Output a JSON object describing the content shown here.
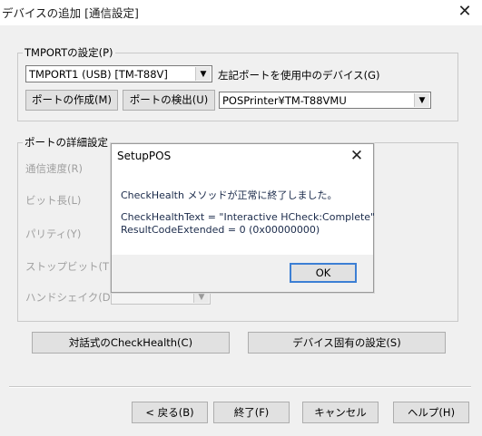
{
  "window": {
    "title": "デバイスの追加 [通信設定]",
    "close_glyph": "✕"
  },
  "tmport": {
    "group_label": "TMPORTの設定(P)",
    "port_combo_value": "TMPORT1 (USB) [TM-T88V]",
    "devices_label": "左記ポートを使用中のデバイス(G)",
    "create_port_button": "ポートの作成(M)",
    "detect_port_button": "ポートの検出(U)",
    "device_combo_value": "POSPrinter¥TM-T88VMU"
  },
  "port_details": {
    "group_label": "ポートの詳細設定",
    "fields": [
      {
        "label": "通信速度(R)"
      },
      {
        "label": "ビット長(L)"
      },
      {
        "label": "パリティ(Y)"
      },
      {
        "label": "ストップビット(T)"
      },
      {
        "label": "ハンドシェイク(D)"
      }
    ]
  },
  "actions": {
    "checkhealth_button": "対話式のCheckHealth(C)",
    "device_settings_button": "デバイス固有の設定(S)"
  },
  "footer": {
    "back_button": "< 戻る(B)",
    "finish_button": "終了(F)",
    "cancel_button": "キャンセル",
    "help_button": "ヘルプ(H)"
  },
  "message_box": {
    "title": "SetupPOS",
    "close_glyph": "✕",
    "line1": "CheckHealth メソッドが正常に終了しました。",
    "line2": "CheckHealthText = \"Interactive HCheck:Complete\"",
    "line3": "ResultCodeExtended = 0 (0x00000000)",
    "ok_button": "OK"
  },
  "icons": {
    "combo_arrow": "▼"
  }
}
